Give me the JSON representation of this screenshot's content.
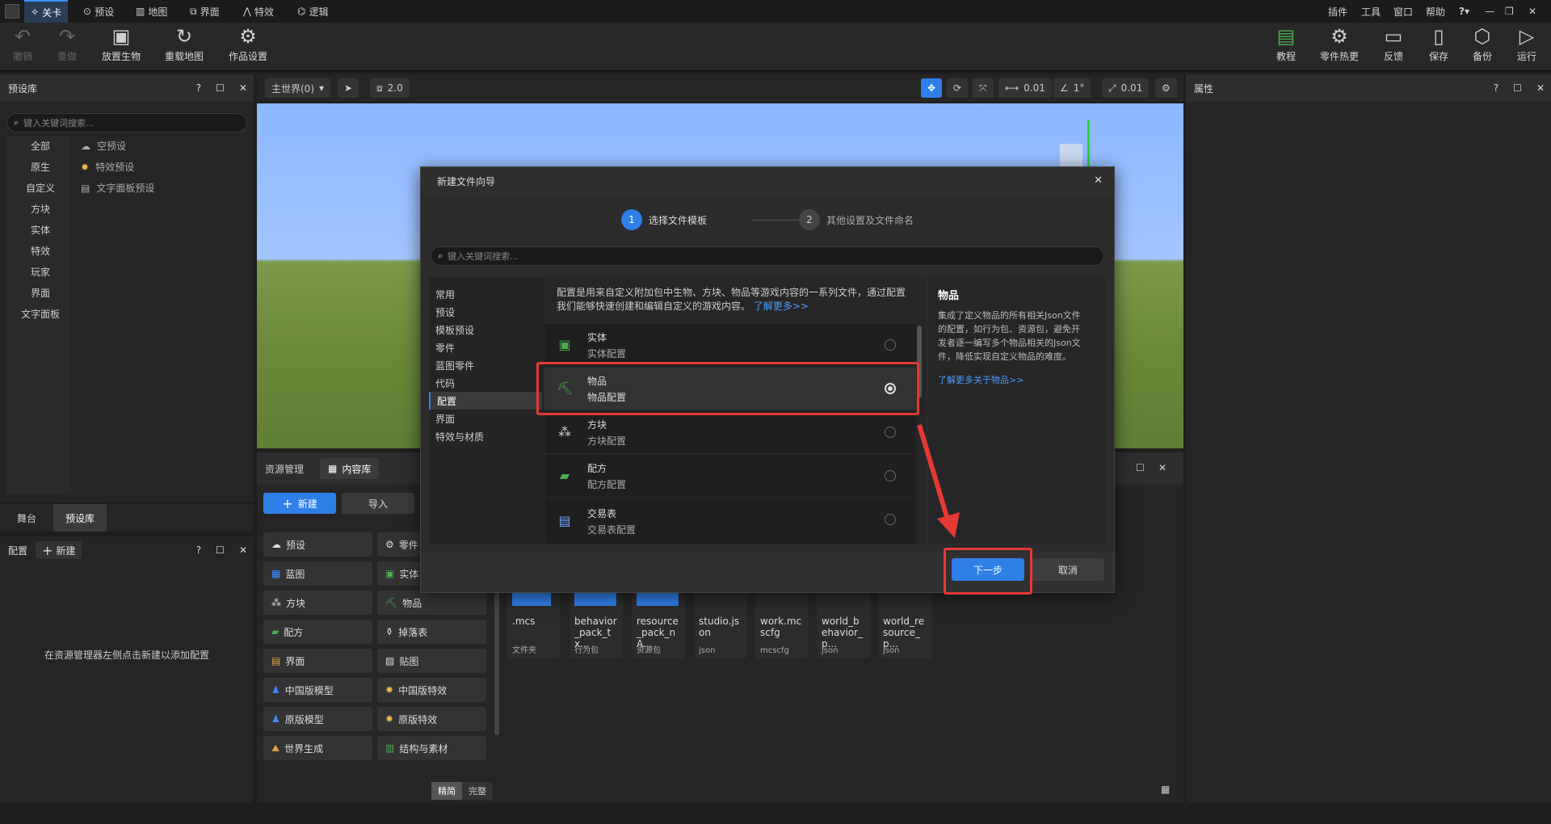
{
  "topbar": {
    "tabs": [
      "关卡",
      "预设",
      "地图",
      "界面",
      "特效",
      "逻辑"
    ],
    "menus": [
      "插件",
      "工具",
      "窗口",
      "帮助"
    ]
  },
  "toolbar": {
    "left": [
      "撤销",
      "重做",
      "放置生物",
      "重载地图",
      "作品设置"
    ],
    "right": [
      "教程",
      "零件热更",
      "反馈",
      "保存",
      "备份",
      "运行"
    ]
  },
  "preset_panel": {
    "title": "预设库",
    "search_placeholder": "键入关键词搜索...",
    "categories": [
      "全部",
      "原生",
      "自定义",
      "方块",
      "实体",
      "特效",
      "玩家",
      "界面",
      "文字面板"
    ],
    "items": [
      "空预设",
      "特效预设",
      "文字面板预设"
    ],
    "bottom_tabs": [
      "舞台",
      "预设库"
    ]
  },
  "config_panel": {
    "title": "配置",
    "new_label": "新建",
    "empty_text": "在资源管理器左侧点击新建以添加配置"
  },
  "viewport": {
    "world": "主世界(0)",
    "speed": "2.0",
    "move_step": "0.01",
    "rotate_step": "1°",
    "scale_step": "0.01"
  },
  "properties_panel": {
    "title": "属性"
  },
  "asset_manager": {
    "title": "资源管理",
    "content_tab": "内容库",
    "new_label": "新建",
    "import_label": "导入",
    "grid_left": [
      "预设",
      "蓝图",
      "方块",
      "配方",
      "界面",
      "中国版模型",
      "原版模型",
      "世界生成"
    ],
    "grid_right": [
      "零件",
      "实体",
      "物品",
      "掉落表",
      "贴图",
      "中国版特效",
      "原版特效",
      "结构与素材"
    ],
    "toggle": [
      "精简",
      "完整"
    ],
    "files": [
      {
        "name": ".mcs",
        "type": "文件夹"
      },
      {
        "name": "behavior_pack_tx...",
        "type": "行为包"
      },
      {
        "name": "resource_pack_nA...",
        "type": "资源包"
      },
      {
        "name": "studio.json",
        "type": "json"
      },
      {
        "name": "work.mcscfg",
        "type": "mcscfg"
      },
      {
        "name": "world_behavior_p...",
        "type": "json"
      },
      {
        "name": "world_resource_p...",
        "type": "json"
      }
    ]
  },
  "dialog": {
    "title": "新建文件向导",
    "step1_num": "1",
    "step1": "选择文件模板",
    "step2_num": "2",
    "step2": "其他设置及文件命名",
    "search_placeholder": "键入关键词搜索...",
    "categories": [
      "常用",
      "预设",
      "模板预设",
      "零件",
      "蓝图零件",
      "代码",
      "配置",
      "界面",
      "特效与材质"
    ],
    "selected_category": "配置",
    "intro_line1": "配置是用来自定义附加包中生物、方块、物品等游戏内容的一系列文件，通过配置",
    "intro_line2": "我们能够快速创建和编辑自定义的游戏内容。",
    "intro_link": "了解更多>>",
    "templates": [
      {
        "title": "实体",
        "subtitle": "实体配置",
        "icon": "creeper-icon"
      },
      {
        "title": "物品",
        "subtitle": "物品配置",
        "icon": "pickaxe-icon"
      },
      {
        "title": "方块",
        "subtitle": "方块配置",
        "icon": "blocks-icon"
      },
      {
        "title": "配方",
        "subtitle": "配方配置",
        "icon": "book-icon"
      },
      {
        "title": "交易表",
        "subtitle": "交易表配置",
        "icon": "trade-icon"
      }
    ],
    "selected_template": "物品",
    "detail_title": "物品",
    "detail_text": [
      "集成了定义物品的所有相关Json文件",
      "的配置，如行为包、资源包，避免开",
      "发者逐一编写多个物品相关的Json文",
      "件，降低实现自定义物品的难度。"
    ],
    "detail_link": "了解更多关于物品>>",
    "next_label": "下一步",
    "cancel_label": "取消"
  },
  "colors": {
    "accent": "#2f7fe8",
    "highlight": "#e53935"
  }
}
